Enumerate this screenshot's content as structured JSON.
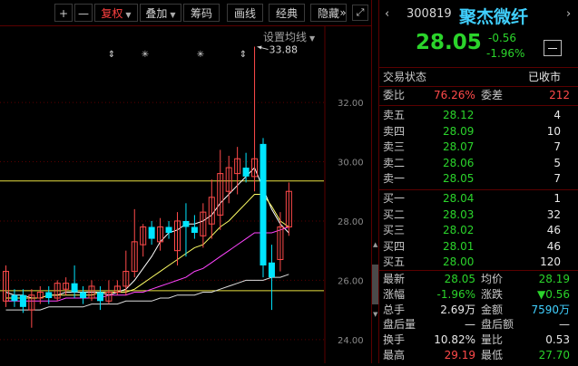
{
  "toolbar": {
    "plus": "+",
    "minus": "—",
    "fuquan": "复权",
    "diejia": "叠加",
    "chouma": "筹码",
    "huaxian": "画线",
    "jingdian": "经典",
    "yincang": "隐藏",
    "more": "»",
    "expand": "⤢"
  },
  "chart": {
    "setting_label": "设置均线",
    "peak_label": "33.88",
    "accent_up": "#ff4a4a",
    "accent_down": "#00e5ff"
  },
  "chart_data": {
    "type": "candlestick",
    "y_ticks": [
      "32.00",
      "30.00",
      "28.00",
      "26.00",
      "24.00"
    ],
    "ylim": [
      23.2,
      34.6
    ],
    "hlines": [
      29.35,
      25.65
    ],
    "annotation": {
      "price": 33.88
    },
    "candles": [
      {
        "o": 25.3,
        "c": 26.3,
        "h": 26.5,
        "l": 25.1
      },
      {
        "o": 25.5,
        "c": 25.3,
        "h": 25.7,
        "l": 25.1
      },
      {
        "o": 25.5,
        "c": 25.1,
        "h": 25.7,
        "l": 24.9
      },
      {
        "o": 25.0,
        "c": 25.5,
        "h": 25.7,
        "l": 24.4
      },
      {
        "o": 25.4,
        "c": 25.6,
        "h": 25.8,
        "l": 25.2
      },
      {
        "o": 25.6,
        "c": 25.4,
        "h": 25.8,
        "l": 25.2
      },
      {
        "o": 25.4,
        "c": 25.9,
        "h": 26.0,
        "l": 25.3
      },
      {
        "o": 25.7,
        "c": 25.9,
        "h": 26.1,
        "l": 25.5
      },
      {
        "o": 25.9,
        "c": 25.6,
        "h": 26.5,
        "l": 25.4
      },
      {
        "o": 25.6,
        "c": 25.4,
        "h": 25.8,
        "l": 25.2
      },
      {
        "o": 25.4,
        "c": 25.8,
        "h": 26.0,
        "l": 25.3
      },
      {
        "o": 25.6,
        "c": 25.3,
        "h": 25.8,
        "l": 25.0
      },
      {
        "o": 25.3,
        "c": 25.6,
        "h": 26.0,
        "l": 25.2
      },
      {
        "o": 25.6,
        "c": 25.8,
        "h": 26.0,
        "l": 25.5
      },
      {
        "o": 25.8,
        "c": 26.3,
        "h": 27.0,
        "l": 25.5
      },
      {
        "o": 26.3,
        "c": 27.3,
        "h": 28.4,
        "l": 26.1
      },
      {
        "o": 27.2,
        "c": 27.8,
        "h": 27.9,
        "l": 26.8
      },
      {
        "o": 27.8,
        "c": 27.4,
        "h": 28.0,
        "l": 27.2
      },
      {
        "o": 27.3,
        "c": 27.8,
        "h": 28.1,
        "l": 27.0
      },
      {
        "o": 27.8,
        "c": 27.6,
        "h": 28.0,
        "l": 27.4
      },
      {
        "o": 27.0,
        "c": 28.0,
        "h": 28.3,
        "l": 26.5
      },
      {
        "o": 28.0,
        "c": 27.8,
        "h": 28.6,
        "l": 26.8
      },
      {
        "o": 27.8,
        "c": 27.6,
        "h": 28.2,
        "l": 27.4
      },
      {
        "o": 27.5,
        "c": 28.3,
        "h": 28.6,
        "l": 27.1
      },
      {
        "o": 27.9,
        "c": 28.8,
        "h": 29.4,
        "l": 27.4
      },
      {
        "o": 28.2,
        "c": 29.6,
        "h": 30.4,
        "l": 27.7
      },
      {
        "o": 29.0,
        "c": 29.8,
        "h": 30.2,
        "l": 28.6
      },
      {
        "o": 29.6,
        "c": 30.1,
        "h": 30.5,
        "l": 28.9
      },
      {
        "o": 29.8,
        "c": 29.5,
        "h": 30.3,
        "l": 29.3
      },
      {
        "o": 29.5,
        "c": 30.1,
        "h": 33.88,
        "l": 29.0
      },
      {
        "o": 30.6,
        "c": 26.5,
        "h": 30.8,
        "l": 26.1
      },
      {
        "o": 26.6,
        "c": 26.1,
        "h": 27.2,
        "l": 25.0
      },
      {
        "o": 26.7,
        "c": 27.8,
        "h": 28.3,
        "l": 26.3
      },
      {
        "o": 27.8,
        "c": 29.0,
        "h": 29.3,
        "l": 27.5
      }
    ],
    "ma_series": [
      {
        "color": "#ffffff",
        "values": [
          25.6,
          25.5,
          25.5,
          25.4,
          25.4,
          25.5,
          25.5,
          25.6,
          25.6,
          25.6,
          25.6,
          25.6,
          25.5,
          25.6,
          25.7,
          26.0,
          26.4,
          26.8,
          27.3,
          27.6,
          27.7,
          27.9,
          27.9,
          28.0,
          28.2,
          28.6,
          28.9,
          29.2,
          29.5,
          29.8,
          29.1,
          28.4,
          27.9,
          27.6
        ]
      },
      {
        "color": "#ffff66",
        "values": [
          25.4,
          25.4,
          25.4,
          25.4,
          25.4,
          25.5,
          25.5,
          25.5,
          25.5,
          25.5,
          25.5,
          25.6,
          25.6,
          25.6,
          25.6,
          25.7,
          25.9,
          26.1,
          26.3,
          26.5,
          26.7,
          26.9,
          27.1,
          27.2,
          27.5,
          27.8,
          28.0,
          28.3,
          28.6,
          28.9,
          28.9,
          28.5,
          28.0,
          27.8
        ]
      },
      {
        "color": "#ff44ff",
        "values": [
          25.3,
          25.3,
          25.3,
          25.3,
          25.3,
          25.3,
          25.3,
          25.4,
          25.4,
          25.4,
          25.4,
          25.4,
          25.5,
          25.5,
          25.5,
          25.6,
          25.6,
          25.7,
          25.8,
          25.9,
          26.0,
          26.1,
          26.3,
          26.4,
          26.6,
          26.8,
          27.0,
          27.2,
          27.4,
          27.6,
          27.6,
          27.6,
          27.7,
          27.8
        ]
      },
      {
        "color": "#dddddd",
        "values": [
          25.0,
          25.0,
          25.0,
          25.0,
          25.0,
          25.1,
          25.1,
          25.1,
          25.1,
          25.1,
          25.2,
          25.2,
          25.2,
          25.2,
          25.3,
          25.3,
          25.3,
          25.3,
          25.4,
          25.4,
          25.5,
          25.5,
          25.5,
          25.6,
          25.6,
          25.7,
          25.8,
          25.9,
          26.0,
          26.0,
          26.0,
          26.1,
          26.1,
          26.2
        ]
      }
    ]
  },
  "quote": {
    "code": "300819",
    "name": "聚杰微纤",
    "price": "28.05",
    "change": "-0.56",
    "change_pct": "-1.96%",
    "status_label": "交易状态",
    "status_value": "已收市",
    "weibi_label": "委比",
    "weibi_value": "76.26%",
    "weicha_label": "委差",
    "weicha_value": "212",
    "asks": [
      {
        "label": "卖五",
        "price": "28.12",
        "vol": "4"
      },
      {
        "label": "卖四",
        "price": "28.09",
        "vol": "10"
      },
      {
        "label": "卖三",
        "price": "28.07",
        "vol": "7"
      },
      {
        "label": "卖二",
        "price": "28.06",
        "vol": "5"
      },
      {
        "label": "卖一",
        "price": "28.05",
        "vol": "7"
      }
    ],
    "bids": [
      {
        "label": "买一",
        "price": "28.04",
        "vol": "1"
      },
      {
        "label": "买二",
        "price": "28.03",
        "vol": "32"
      },
      {
        "label": "买三",
        "price": "28.02",
        "vol": "46"
      },
      {
        "label": "买四",
        "price": "28.01",
        "vol": "46"
      },
      {
        "label": "买五",
        "price": "28.00",
        "vol": "120"
      }
    ],
    "stats": [
      {
        "l1": "最新",
        "v1": "28.05",
        "l2": "均价",
        "v2": "28.19"
      },
      {
        "l1": "涨幅",
        "v1": "-1.96%",
        "l2": "涨跌",
        "v2": "▼0.56"
      },
      {
        "l1": "总手",
        "v1": "2.69万",
        "l2": "金额",
        "v2": "7590万"
      },
      {
        "l1": "盘后量",
        "v1": "—",
        "l2": "盘后额",
        "v2": "—"
      },
      {
        "l1": "换手",
        "v1": "10.82%",
        "l2": "量比",
        "v2": "0.53"
      },
      {
        "l1": "最高",
        "v1": "29.19",
        "l2": "最低",
        "v2": "27.70"
      }
    ]
  }
}
